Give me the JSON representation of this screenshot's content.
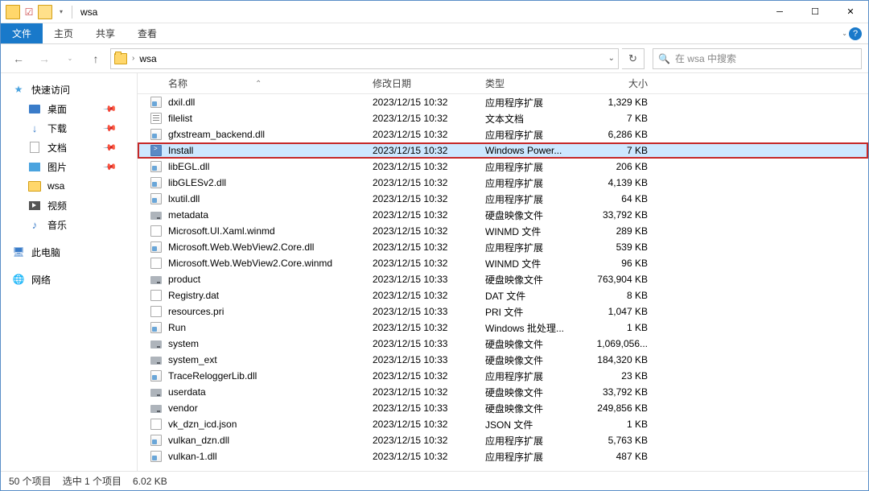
{
  "titlebar": {
    "title": "wsa"
  },
  "ribbon": {
    "file": "文件",
    "tabs": [
      "主页",
      "共享",
      "查看"
    ]
  },
  "nav": {
    "crumb": "wsa",
    "search_placeholder": "在 wsa 中搜索"
  },
  "sidebar": {
    "quick": "快速访问",
    "quick_items": [
      {
        "label": "桌面",
        "icon": "desktop",
        "pinned": true
      },
      {
        "label": "下载",
        "icon": "download",
        "pinned": true
      },
      {
        "label": "文档",
        "icon": "docs",
        "pinned": true
      },
      {
        "label": "图片",
        "icon": "pics",
        "pinned": true
      },
      {
        "label": "wsa",
        "icon": "folder",
        "pinned": false
      },
      {
        "label": "视频",
        "icon": "video",
        "pinned": false
      },
      {
        "label": "音乐",
        "icon": "music",
        "pinned": false
      }
    ],
    "this_pc": "此电脑",
    "network": "网络"
  },
  "columns": {
    "name": "名称",
    "date": "修改日期",
    "type": "类型",
    "size": "大小"
  },
  "files": [
    {
      "name": "dxil.dll",
      "date": "2023/12/15 10:32",
      "type": "应用程序扩展",
      "size": "1,329 KB",
      "icon": "dll"
    },
    {
      "name": "filelist",
      "date": "2023/12/15 10:32",
      "type": "文本文档",
      "size": "7 KB",
      "icon": "txt"
    },
    {
      "name": "gfxstream_backend.dll",
      "date": "2023/12/15 10:32",
      "type": "应用程序扩展",
      "size": "6,286 KB",
      "icon": "dll"
    },
    {
      "name": "Install",
      "date": "2023/12/15 10:32",
      "type": "Windows Power...",
      "size": "7 KB",
      "icon": "ps",
      "selected": true,
      "highlighted": true
    },
    {
      "name": "libEGL.dll",
      "date": "2023/12/15 10:32",
      "type": "应用程序扩展",
      "size": "206 KB",
      "icon": "dll"
    },
    {
      "name": "libGLESv2.dll",
      "date": "2023/12/15 10:32",
      "type": "应用程序扩展",
      "size": "4,139 KB",
      "icon": "dll"
    },
    {
      "name": "lxutil.dll",
      "date": "2023/12/15 10:32",
      "type": "应用程序扩展",
      "size": "64 KB",
      "icon": "dll"
    },
    {
      "name": "metadata",
      "date": "2023/12/15 10:32",
      "type": "硬盘映像文件",
      "size": "33,792 KB",
      "icon": "disk"
    },
    {
      "name": "Microsoft.UI.Xaml.winmd",
      "date": "2023/12/15 10:32",
      "type": "WINMD 文件",
      "size": "289 KB",
      "icon": "winmd"
    },
    {
      "name": "Microsoft.Web.WebView2.Core.dll",
      "date": "2023/12/15 10:32",
      "type": "应用程序扩展",
      "size": "539 KB",
      "icon": "dll"
    },
    {
      "name": "Microsoft.Web.WebView2.Core.winmd",
      "date": "2023/12/15 10:32",
      "type": "WINMD 文件",
      "size": "96 KB",
      "icon": "winmd"
    },
    {
      "name": "product",
      "date": "2023/12/15 10:33",
      "type": "硬盘映像文件",
      "size": "763,904 KB",
      "icon": "disk"
    },
    {
      "name": "Registry.dat",
      "date": "2023/12/15 10:32",
      "type": "DAT 文件",
      "size": "8 KB",
      "icon": "dat"
    },
    {
      "name": "resources.pri",
      "date": "2023/12/15 10:33",
      "type": "PRI 文件",
      "size": "1,047 KB",
      "icon": "pri"
    },
    {
      "name": "Run",
      "date": "2023/12/15 10:32",
      "type": "Windows 批处理...",
      "size": "1 KB",
      "icon": "bat"
    },
    {
      "name": "system",
      "date": "2023/12/15 10:33",
      "type": "硬盘映像文件",
      "size": "1,069,056...",
      "icon": "disk"
    },
    {
      "name": "system_ext",
      "date": "2023/12/15 10:33",
      "type": "硬盘映像文件",
      "size": "184,320 KB",
      "icon": "disk"
    },
    {
      "name": "TraceReloggerLib.dll",
      "date": "2023/12/15 10:32",
      "type": "应用程序扩展",
      "size": "23 KB",
      "icon": "dll"
    },
    {
      "name": "userdata",
      "date": "2023/12/15 10:32",
      "type": "硬盘映像文件",
      "size": "33,792 KB",
      "icon": "disk"
    },
    {
      "name": "vendor",
      "date": "2023/12/15 10:33",
      "type": "硬盘映像文件",
      "size": "249,856 KB",
      "icon": "disk"
    },
    {
      "name": "vk_dzn_icd.json",
      "date": "2023/12/15 10:32",
      "type": "JSON 文件",
      "size": "1 KB",
      "icon": "json"
    },
    {
      "name": "vulkan_dzn.dll",
      "date": "2023/12/15 10:32",
      "type": "应用程序扩展",
      "size": "5,763 KB",
      "icon": "dll"
    },
    {
      "name": "vulkan-1.dll",
      "date": "2023/12/15 10:32",
      "type": "应用程序扩展",
      "size": "487 KB",
      "icon": "dll"
    }
  ],
  "status": {
    "items": "50 个项目",
    "selected": "选中 1 个项目",
    "size": "6.02 KB"
  }
}
